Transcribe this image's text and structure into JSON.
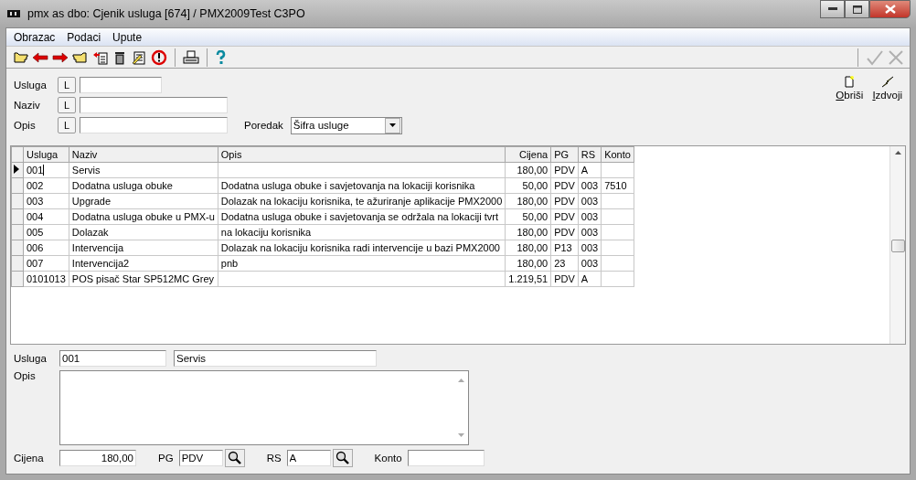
{
  "window": {
    "title": "pmx as dbo: Cjenik usluga [674] / PMX2009Test C3PO"
  },
  "menu": [
    "Obrazac",
    "Podaci",
    "Upute"
  ],
  "confirm_buttons": [
    {
      "kind": "check",
      "disabled": true
    },
    {
      "kind": "cancel",
      "disabled": true
    }
  ],
  "filters": [
    {
      "label": "Usluga",
      "button": "L",
      "kind": "short"
    },
    {
      "label": "Naziv",
      "button": "L",
      "kind": "long"
    },
    {
      "label": "Opis",
      "button": "L",
      "kind": "long"
    }
  ],
  "order": {
    "label": "Poredak",
    "value": "Šifra usluge"
  },
  "actions": [
    {
      "kind": "new",
      "label": "Obriši"
    },
    {
      "kind": "extract",
      "label": "Izdvoji"
    }
  ],
  "table": {
    "columns": [
      {
        "label": "Usluga",
        "kind": "text"
      },
      {
        "label": "Naziv",
        "kind": "text"
      },
      {
        "label": "Opis",
        "kind": "text"
      },
      {
        "label": "Cijena",
        "kind": "number"
      },
      {
        "label": "PG",
        "kind": "text"
      },
      {
        "label": "RS",
        "kind": "text"
      },
      {
        "label": "Konto",
        "kind": "text"
      }
    ],
    "rows": [
      {
        "selected": true,
        "cells": [
          "001",
          "Servis",
          "",
          "180,00",
          "PDV",
          "A",
          ""
        ]
      },
      {
        "selected": false,
        "cells": [
          "002",
          "Dodatna usluga obuke",
          "Dodatna usluga obuke i savjetovanja na lokaciji korisnika",
          "50,00",
          "PDV",
          "003",
          "7510"
        ]
      },
      {
        "selected": false,
        "cells": [
          "003",
          "Upgrade",
          "Dolazak na lokaciju korisnika, te ažuriranje aplikacije PMX2000",
          "180,00",
          "PDV",
          "003",
          ""
        ]
      },
      {
        "selected": false,
        "cells": [
          "004",
          "Dodatna usluga obuke u PMX-u",
          "Dodatna usluga obuke i savjetovanja se održala na lokaciji tvrt",
          "50,00",
          "PDV",
          "003",
          ""
        ]
      },
      {
        "selected": false,
        "cells": [
          "005",
          "Dolazak",
          "na lokaciju korisnika",
          "180,00",
          "PDV",
          "003",
          ""
        ]
      },
      {
        "selected": false,
        "cells": [
          "006",
          "Intervencija",
          "Dolazak na lokaciju korisnika radi intervencije u bazi PMX2000",
          "180,00",
          "P13",
          "003",
          ""
        ]
      },
      {
        "selected": false,
        "cells": [
          "007",
          "Intervencija2",
          "pnb",
          "180,00",
          "23",
          "003",
          ""
        ]
      },
      {
        "selected": false,
        "cells": [
          "0101013",
          "POS pisač Star SP512MC Grey",
          "",
          "1.219,51",
          "PDV",
          "A",
          ""
        ]
      }
    ]
  },
  "detail": {
    "code_label": "Usluga",
    "code": "001",
    "name": "Servis",
    "description_label": "Opis",
    "price_label": "Cijena",
    "price": "180,00",
    "pg_label": "PG",
    "pg": "PDV",
    "rs_label": "RS",
    "rs": "A",
    "konto_label": "Konto"
  }
}
